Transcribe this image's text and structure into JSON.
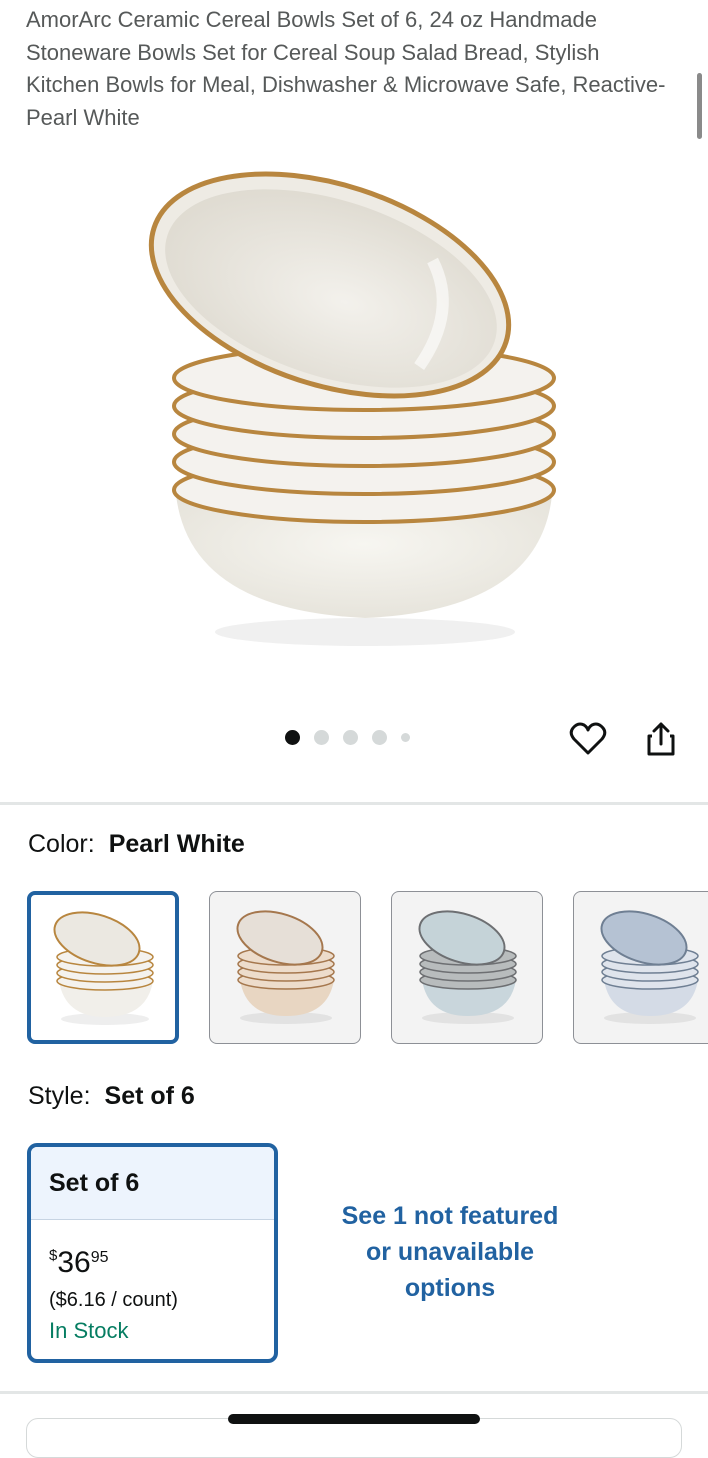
{
  "product": {
    "title": "AmorArc Ceramic Cereal Bowls Set of 6, 24 oz Handmade Stoneware Bowls Set for Cereal Soup Salad Bread, Stylish Kitchen Bowls for Meal, Dishwasher & Microwave Safe, Reactive-Pearl White"
  },
  "gallery": {
    "image_count": 5,
    "active_index": 0,
    "icons": [
      "heart-icon",
      "share-icon"
    ]
  },
  "color": {
    "label": "Color:",
    "selected": "Pearl White",
    "options": [
      {
        "name": "pearl-white",
        "rim": "#b8863f",
        "glaze": "#f1efea"
      },
      {
        "name": "beige",
        "rim": "#a5774d",
        "glaze": "#e8d6c2"
      },
      {
        "name": "blue-grey",
        "rim": "#6d6f72",
        "glaze": "#c9d6dc"
      },
      {
        "name": "light-blue",
        "rim": "#6f7f93",
        "glaze": "#d4dbe6"
      }
    ]
  },
  "style": {
    "label": "Style:",
    "selected": "Set of 6",
    "card": {
      "name": "Set of 6",
      "currency": "$",
      "price_whole": "36",
      "price_fraction": "95",
      "unit_price": "($6.16 / count)",
      "availability": "In Stock"
    },
    "more_options": "See 1 not featured or unavailable options"
  },
  "colors": {
    "link": "#2162a1",
    "in_stock": "#067d62",
    "text": "#0f1111",
    "secondary_text": "#565959"
  }
}
